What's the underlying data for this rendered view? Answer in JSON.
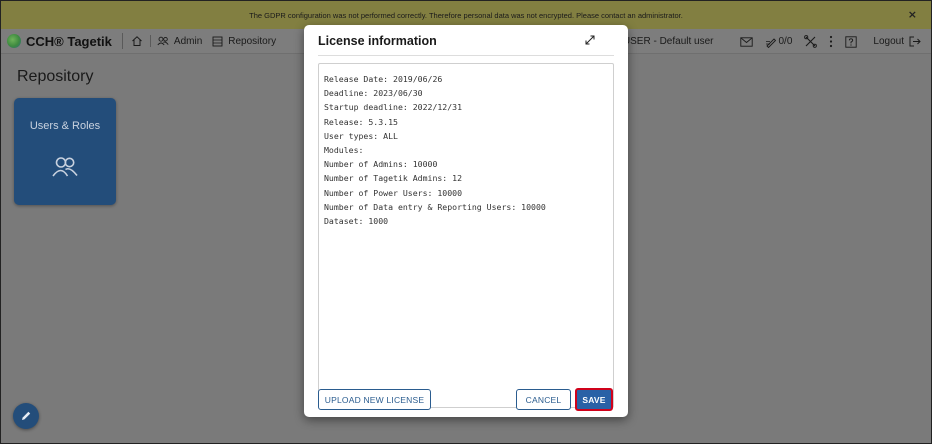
{
  "gdpr_banner": {
    "message": "The GDPR configuration was not performed correctly. Therefore personal data was not encrypted. Please contact an administrator.",
    "close_glyph": "×"
  },
  "topbar": {
    "brand": "CCH® Tagetik",
    "breadcrumb": [
      {
        "label": "Admin"
      },
      {
        "label": "Repository"
      }
    ],
    "user": "$USER - Default user",
    "jobs_counter": "0/0",
    "logout_label": "Logout"
  },
  "page": {
    "title": "Repository"
  },
  "tiles": [
    {
      "label": "Users & Roles"
    }
  ],
  "modal": {
    "title": "License information",
    "license_lines": [
      "Release Date: 2019/06/26",
      "Deadline: 2023/06/30",
      "Startup deadline: 2022/12/31",
      "Release: 5.3.15",
      "User types: ALL",
      "Modules:",
      "Number of Admins: 10000",
      "Number of Tagetik Admins: 12",
      "Number of Power Users: 10000",
      "Number of Data entry & Reporting Users: 10000",
      "Dataset: 1000"
    ],
    "buttons": {
      "upload": "UPLOAD NEW LICENSE",
      "cancel": "CANCEL",
      "save": "SAVE"
    }
  },
  "colors": {
    "primary": "#2961a6",
    "tile": "#234d7a",
    "banner": "#827f41",
    "highlight": "#d0021b"
  }
}
